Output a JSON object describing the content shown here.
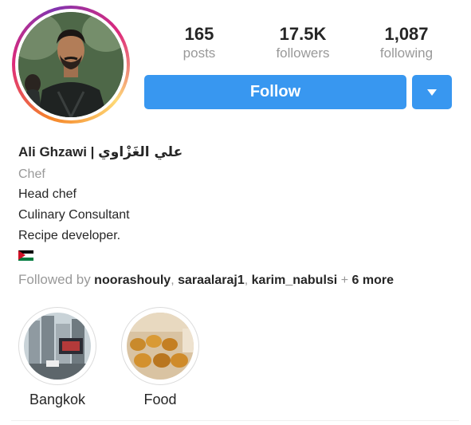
{
  "profile": {
    "name_en": "Ali Ghzawi |",
    "name_ar": "علي الغَزْاوي",
    "category": "Chef",
    "bio": [
      "Head chef",
      "Culinary Consultant",
      "Recipe developer."
    ]
  },
  "stats": [
    {
      "value": "165",
      "label": "posts"
    },
    {
      "value": "17.5K",
      "label": "followers"
    },
    {
      "value": "1,087",
      "label": "following"
    }
  ],
  "actions": {
    "follow_label": "Follow"
  },
  "followed_by": {
    "prefix": "Followed by",
    "users": [
      "noorashouly",
      "saraalaraj1",
      "karim_nabulsi"
    ],
    "sep1": ",",
    "sep2": ",",
    "more_prefix": "+",
    "more": "6 more"
  },
  "highlights": [
    {
      "label": "Bangkok"
    },
    {
      "label": "Food"
    }
  ],
  "colors": {
    "accent": "#3897f0",
    "muted": "#999999",
    "text": "#262626"
  }
}
